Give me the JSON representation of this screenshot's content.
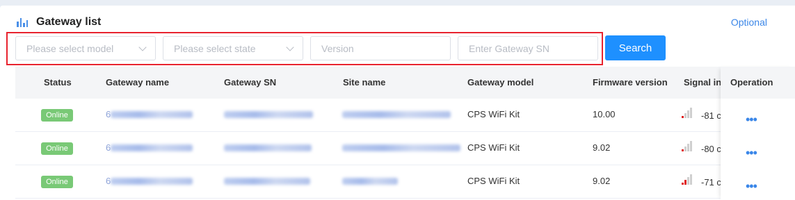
{
  "header": {
    "title": "Gateway list",
    "optional_link": "Optional"
  },
  "filters": {
    "model_placeholder": "Please select model",
    "state_placeholder": "Please select state",
    "version_placeholder": "Version",
    "sn_placeholder": "Enter Gateway SN",
    "search_label": "Search"
  },
  "table": {
    "columns": [
      "Status",
      "Gateway name",
      "Gateway SN",
      "Site name",
      "Gateway model",
      "Firmware version",
      "Signal in",
      "Operation"
    ],
    "rows": [
      {
        "status": "Online",
        "name_prefix": "6",
        "model": "CPS WiFi Kit",
        "firmware": "10.00",
        "signal": "-81 c"
      },
      {
        "status": "Online",
        "name_prefix": "6",
        "model": "CPS WiFi Kit",
        "firmware": "9.02",
        "signal": "-80 c"
      },
      {
        "status": "Online",
        "name_prefix": "6",
        "model": "CPS WiFi Kit",
        "firmware": "9.02",
        "signal": "-71 c"
      }
    ],
    "operation_glyph": "•••"
  },
  "colors": {
    "accent": "#1e90ff",
    "online": "#79c976",
    "highlight_border": "#e8232f",
    "signal_low": "#e02020"
  }
}
